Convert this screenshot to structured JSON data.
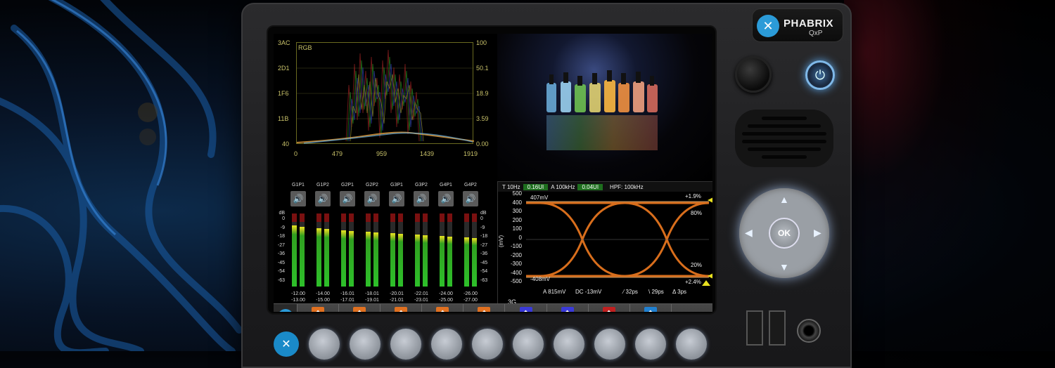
{
  "brand": {
    "name": "PHABRIX",
    "model": "QxP",
    "logo_icon": "phabrix-x-icon",
    "accent": "#2b9bd8"
  },
  "waveform": {
    "mode_label": "RGB",
    "y_left": [
      "3AC",
      "2D1",
      "1F6",
      "11B",
      "40"
    ],
    "y_right": [
      "100",
      "50.1",
      "18.9",
      "3.59",
      "0.00"
    ],
    "x_ticks": [
      "0",
      "479",
      "959",
      "1439",
      "1919"
    ]
  },
  "audio": {
    "scale_label": "dB",
    "scale": [
      "0",
      "-9",
      "-18",
      "-27",
      "-36",
      "-45",
      "-54",
      "-63"
    ],
    "meters": [
      {
        "label": "G1P1",
        "top": "-12.00",
        "bottom": "-13.00",
        "left_level": 0.84,
        "right_level": 0.82
      },
      {
        "label": "G1P2",
        "top": "-14.00",
        "bottom": "-15.00",
        "left_level": 0.8,
        "right_level": 0.79
      },
      {
        "label": "G2P1",
        "top": "-16.01",
        "bottom": "-17.01",
        "left_level": 0.77,
        "right_level": 0.76
      },
      {
        "label": "G2P2",
        "top": "-18.01",
        "bottom": "-19.01",
        "left_level": 0.75,
        "right_level": 0.74
      },
      {
        "label": "G3P1",
        "top": "-20.01",
        "bottom": "-21.01",
        "left_level": 0.73,
        "right_level": 0.72
      },
      {
        "label": "G3P2",
        "top": "-22.01",
        "bottom": "-23.01",
        "left_level": 0.71,
        "right_level": 0.7
      },
      {
        "label": "G4P1",
        "top": "-24.00",
        "bottom": "-25.00",
        "left_level": 0.69,
        "right_level": 0.68
      },
      {
        "label": "G4P2",
        "top": "-26.00",
        "bottom": "-27.00",
        "left_level": 0.67,
        "right_level": 0.66
      }
    ]
  },
  "eye": {
    "topbar": {
      "t_label": "T 10Hz",
      "t_value": "0.16UI",
      "a_label": "A 100kHz",
      "a_value": "0.04UI",
      "hpf": "HPF: 100kHz"
    },
    "y_ticks": [
      "500",
      "400",
      "300",
      "200",
      "100",
      "0",
      "-100",
      "-200",
      "-300",
      "-400",
      "-500"
    ],
    "y_unit": "(mV)",
    "max_level": "407mV",
    "min_level": "-408mV",
    "overshoot_top": "+1.9%",
    "overshoot_bottom": "+2.4%",
    "pct_80": "80%",
    "pct_20": "20%",
    "rate": "3G",
    "amplitude": "A 815mV",
    "dc": "DC -13mV",
    "rise": "⁄ 32ps",
    "fall": "\\ 29ps",
    "delta": "Δ 3ps"
  },
  "navbar": {
    "items": [
      {
        "label": "Picture",
        "icon": "picture-icon",
        "color": "#e07020"
      },
      {
        "label": "Waveform",
        "icon": "waveform-icon",
        "color": "#e07020"
      },
      {
        "label": "Vectorscope",
        "icon": "vectorscope-icon",
        "color": "#e07020"
      },
      {
        "label": "CIE",
        "icon": "cie-icon",
        "color": "#e07020"
      },
      {
        "label": "Audio Meters",
        "icon": "audio-meters-icon",
        "color": "#e07020"
      },
      {
        "label": "Eye",
        "icon": "eye-icon",
        "color": "#3a3ad8"
      },
      {
        "label": "Jitter",
        "icon": "jitter-icon",
        "color": "#3a3ad8"
      },
      {
        "label": "Stats A",
        "icon": "stats-icon",
        "color": "#c02020"
      },
      {
        "label": "Generator",
        "icon": "generator-icon",
        "color": "#2080d0"
      },
      {
        "label": "Next...",
        "icon": "",
        "color": ""
      }
    ]
  },
  "controls": {
    "ok_label": "OK"
  }
}
